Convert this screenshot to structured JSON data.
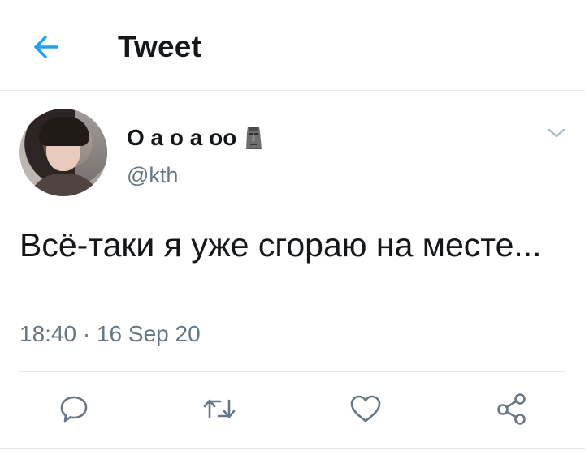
{
  "header": {
    "title": "Tweet",
    "back_icon": "back-arrow-icon"
  },
  "tweet": {
    "display_name": "О а о а оо",
    "emoji_icon": "moai-icon",
    "handle": "@kth",
    "text": "Всё-таки я уже сгораю на месте...",
    "time": "18:40",
    "separator": "·",
    "date": "16 Sep 20"
  },
  "actions": [
    "reply-icon",
    "retweet-icon",
    "like-icon",
    "share-icon"
  ],
  "colors": {
    "accent": "#1da1f2",
    "text": "#14171a",
    "secondary": "#657786",
    "divider": "#e1e8ed"
  }
}
